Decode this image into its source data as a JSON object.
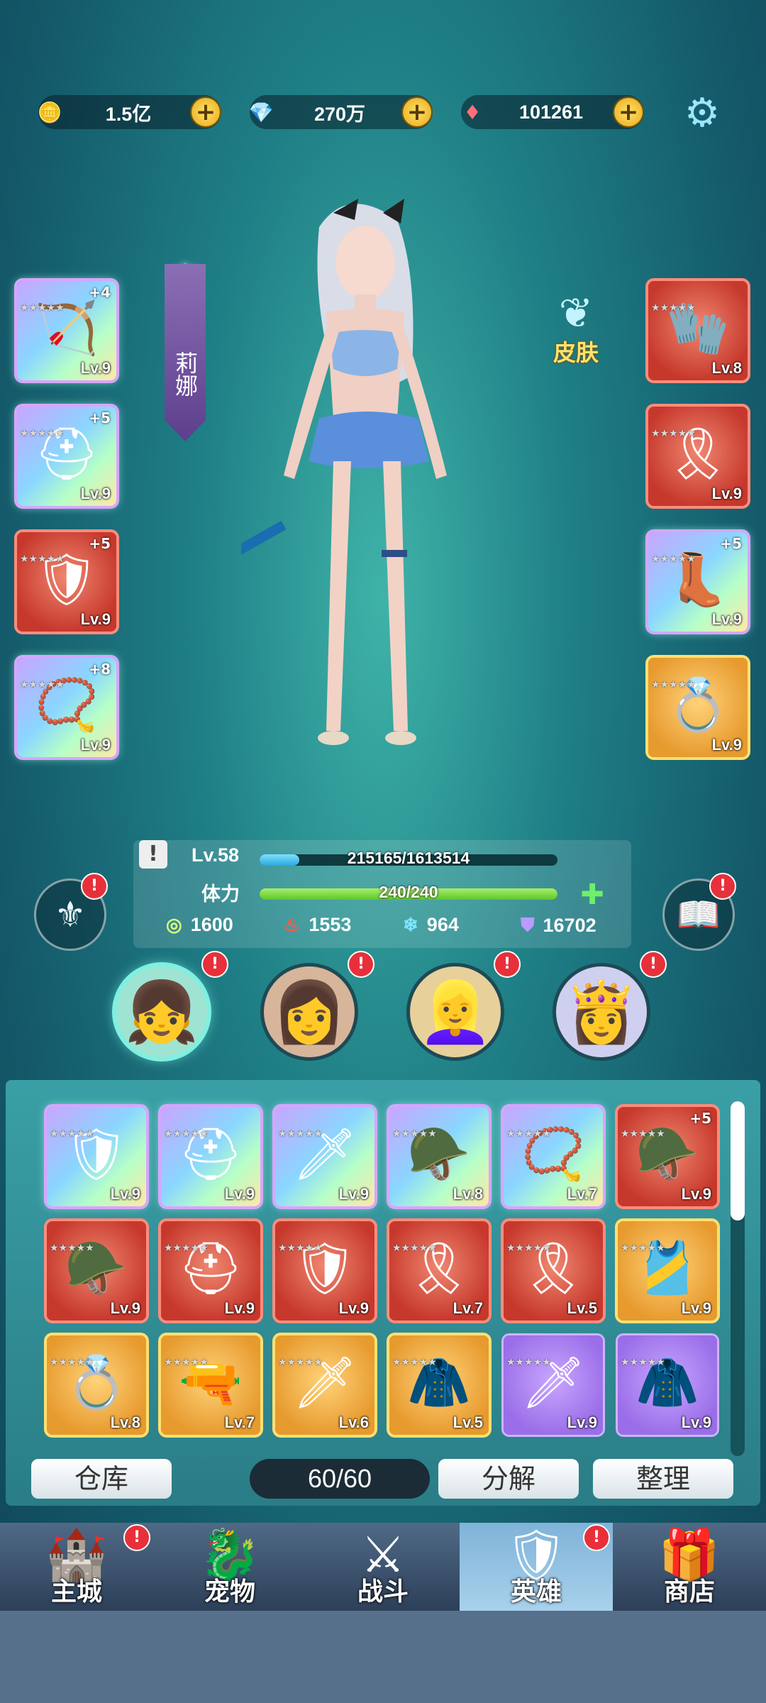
{
  "currency": [
    {
      "icon": "gold-coin-icon",
      "glyph": "🪙",
      "value": "1.5亿"
    },
    {
      "icon": "purple-crystal-icon",
      "glyph": "💎",
      "value": "270万"
    },
    {
      "icon": "red-diamond-icon",
      "glyph": "♦",
      "value": "101261"
    }
  ],
  "plus_glyph": "+",
  "hero": {
    "name": "莉娜",
    "skin_label": "皮肤",
    "level_label": "Lv.58",
    "exp_text": "215165/1613514",
    "exp_fraction": 0.133,
    "stamina_label": "体力",
    "stamina_text": "240/240",
    "stamina_fraction": 1.0,
    "attrs": [
      "1600",
      "1553",
      "964",
      "16702"
    ],
    "excl": "!"
  },
  "left_slots": [
    {
      "plus": "+4",
      "lv": "Lv.9",
      "rarity": "rainbow",
      "item": "🏹"
    },
    {
      "plus": "+5",
      "lv": "Lv.9",
      "rarity": "rainbow",
      "item": "⛑"
    },
    {
      "plus": "+5",
      "lv": "Lv.9",
      "rarity": "red",
      "item": "🛡"
    },
    {
      "plus": "+8",
      "lv": "Lv.9",
      "rarity": "rainbow",
      "item": "📿"
    }
  ],
  "right_slots": [
    {
      "plus": "",
      "lv": "Lv.8",
      "rarity": "red",
      "item": "🧤"
    },
    {
      "plus": "",
      "lv": "Lv.9",
      "rarity": "red",
      "item": "🎗"
    },
    {
      "plus": "+5",
      "lv": "Lv.9",
      "rarity": "rainbow",
      "item": "👢"
    },
    {
      "plus": "",
      "lv": "Lv.9",
      "rarity": "orange",
      "item": "💍"
    }
  ],
  "inventory": [
    {
      "plus": "",
      "lv": "Lv.9",
      "rarity": "rainbow",
      "item": "🛡"
    },
    {
      "plus": "",
      "lv": "Lv.9",
      "rarity": "rainbow",
      "item": "⛑"
    },
    {
      "plus": "",
      "lv": "Lv.9",
      "rarity": "rainbow",
      "item": "🗡"
    },
    {
      "plus": "",
      "lv": "Lv.8",
      "rarity": "rainbow",
      "item": "🪖"
    },
    {
      "plus": "",
      "lv": "Lv.7",
      "rarity": "rainbow",
      "item": "📿"
    },
    {
      "plus": "+5",
      "lv": "Lv.9",
      "rarity": "red",
      "item": "🪖"
    },
    {
      "plus": "",
      "lv": "Lv.9",
      "rarity": "red",
      "item": "🪖"
    },
    {
      "plus": "",
      "lv": "Lv.9",
      "rarity": "red",
      "item": "⛑"
    },
    {
      "plus": "",
      "lv": "Lv.9",
      "rarity": "red",
      "item": "🛡"
    },
    {
      "plus": "",
      "lv": "Lv.7",
      "rarity": "red",
      "item": "🎗"
    },
    {
      "plus": "",
      "lv": "Lv.5",
      "rarity": "red",
      "item": "🎗"
    },
    {
      "plus": "",
      "lv": "Lv.9",
      "rarity": "orange",
      "item": "🎽"
    },
    {
      "plus": "",
      "lv": "Lv.8",
      "rarity": "orange",
      "item": "💍"
    },
    {
      "plus": "",
      "lv": "Lv.7",
      "rarity": "orange",
      "item": "🔫"
    },
    {
      "plus": "",
      "lv": "Lv.6",
      "rarity": "orange",
      "item": "🗡"
    },
    {
      "plus": "",
      "lv": "Lv.5",
      "rarity": "orange",
      "item": "🧥"
    },
    {
      "plus": "",
      "lv": "Lv.9",
      "rarity": "purple",
      "item": "🗡"
    },
    {
      "plus": "",
      "lv": "Lv.9",
      "rarity": "purple",
      "item": "🧥"
    }
  ],
  "inventory_buttons": {
    "storage": "仓库",
    "count": "60/60",
    "decompose": "分解",
    "sort": "整理"
  },
  "nav": [
    {
      "label": "主城",
      "icon": "castle-icon",
      "glyph": "🏰",
      "badge": true,
      "active": false
    },
    {
      "label": "宠物",
      "icon": "pet-icon",
      "glyph": "🐉",
      "badge": false,
      "active": false
    },
    {
      "label": "战斗",
      "icon": "battle-icon",
      "glyph": "⚔",
      "badge": false,
      "active": false
    },
    {
      "label": "英雄",
      "icon": "hero-icon",
      "glyph": "🛡",
      "badge": true,
      "active": true
    },
    {
      "label": "商店",
      "icon": "shop-icon",
      "glyph": "🎁",
      "badge": false,
      "active": false
    }
  ]
}
